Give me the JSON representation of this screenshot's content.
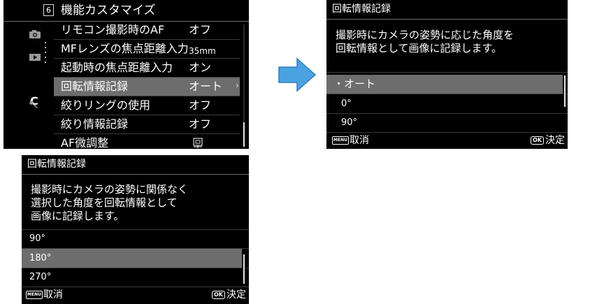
{
  "menu": {
    "page": "6",
    "title": "機能カスタマイズ",
    "side_icons": [
      "camera-icon",
      "playback-icon",
      "custom-icon",
      "wrench-icon"
    ],
    "side_c": "C",
    "rows": [
      {
        "label": "リモコン撮影時のAF",
        "value": "オフ"
      },
      {
        "label": "MFレンズの焦点距離入力",
        "value": "35mm"
      },
      {
        "label": "起動時の焦点距離入力",
        "value": "オン"
      },
      {
        "label": "回転情報記録",
        "value": "オート",
        "arrow": "›"
      },
      {
        "label": "絞りリングの使用",
        "value": "オフ"
      },
      {
        "label": "絞り情報記録",
        "value": "オフ"
      },
      {
        "label": "AF微調整",
        "icon": "af-adjust-icon"
      }
    ]
  },
  "arrow": {
    "color": "#4aa3e0"
  },
  "rot_auto": {
    "title": "回転情報記録",
    "desc": [
      "撮影時にカメラの姿勢に応じた角度を",
      "回転情報として画像に記録します。"
    ],
    "options": [
      "・オート",
      "0°",
      "90°"
    ],
    "footer": {
      "menu_key": "MENU",
      "cancel": "取消",
      "ok_key": "OK",
      "confirm": "決定"
    }
  },
  "rot_manual": {
    "title": "回転情報記録",
    "desc": [
      "撮影時にカメラの姿勢に関係なく",
      "選択した角度を回転情報として",
      "画像に記録します。"
    ],
    "options": [
      "90°",
      "180°",
      "270°"
    ],
    "footer": {
      "menu_key": "MENU",
      "cancel": "取消",
      "ok_key": "OK",
      "confirm": "決定"
    }
  }
}
